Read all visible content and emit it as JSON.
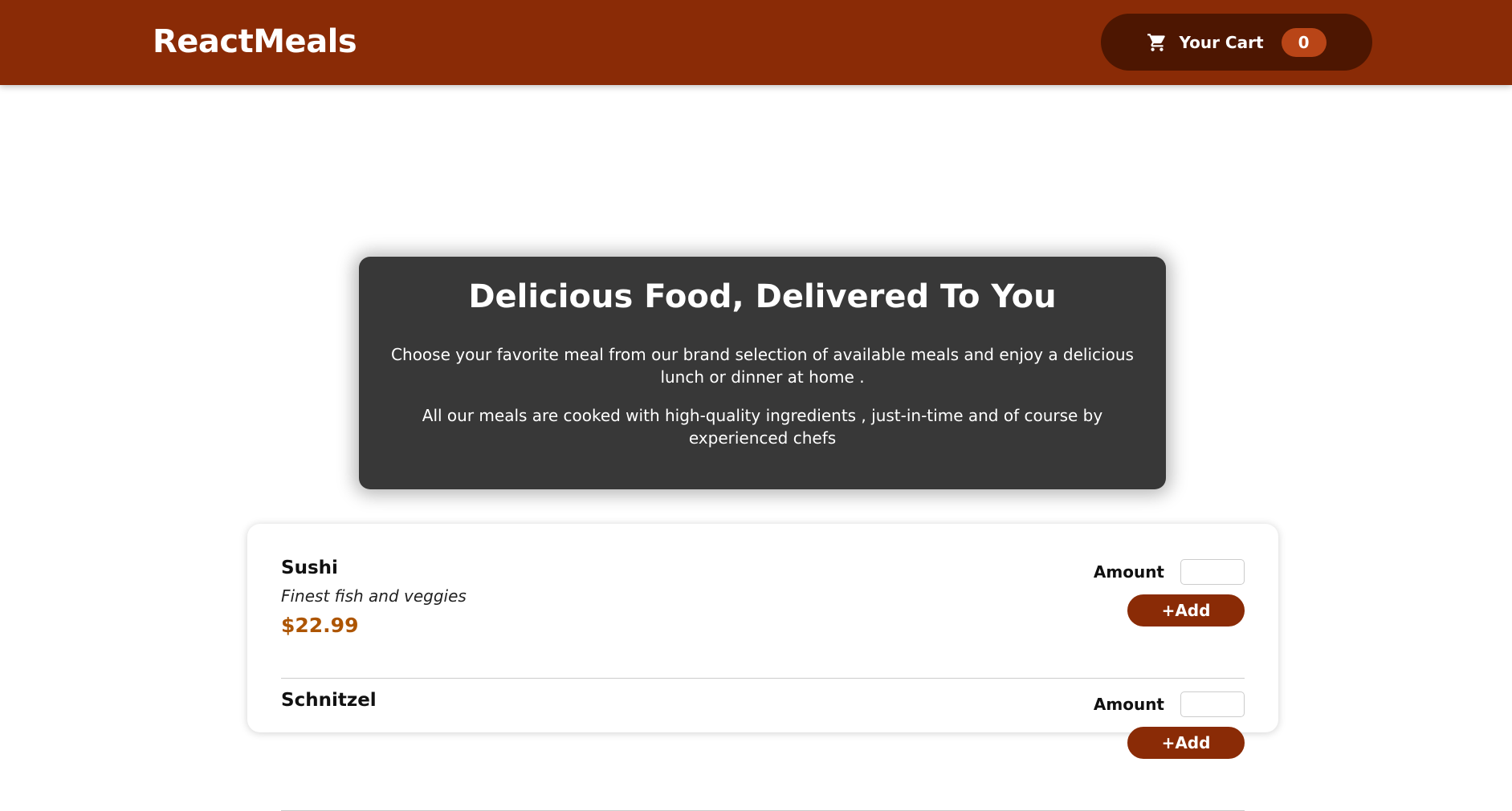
{
  "header": {
    "logo": "ReactMeals",
    "cart": {
      "icon": "cart-icon",
      "label": "Your Cart",
      "count": "0"
    }
  },
  "summary": {
    "title": "Delicious Food, Delivered To You",
    "paragraph1": "Choose your favorite meal from our brand selection of available meals and enjoy a delicious lunch or dinner at home .",
    "paragraph2": "All our meals are cooked with high-quality ingredients , just-in-time and of course by experienced chefs"
  },
  "meals": [
    {
      "name": "Sushi",
      "description": "Finest fish and veggies",
      "price": "$22.99",
      "amount_label": "Amount",
      "amount_value": "",
      "add_label": "+Add"
    },
    {
      "name": "Schnitzel",
      "description": "",
      "price": "",
      "amount_label": "Amount",
      "amount_value": "",
      "add_label": "+Add"
    }
  ],
  "colors": {
    "header_bg": "#8a2b06",
    "cart_button_bg": "#4d1601",
    "cart_badge_bg": "#b94517",
    "summary_bg": "#383838",
    "price": "#ad5502",
    "add_button_bg": "#8a2b06"
  }
}
